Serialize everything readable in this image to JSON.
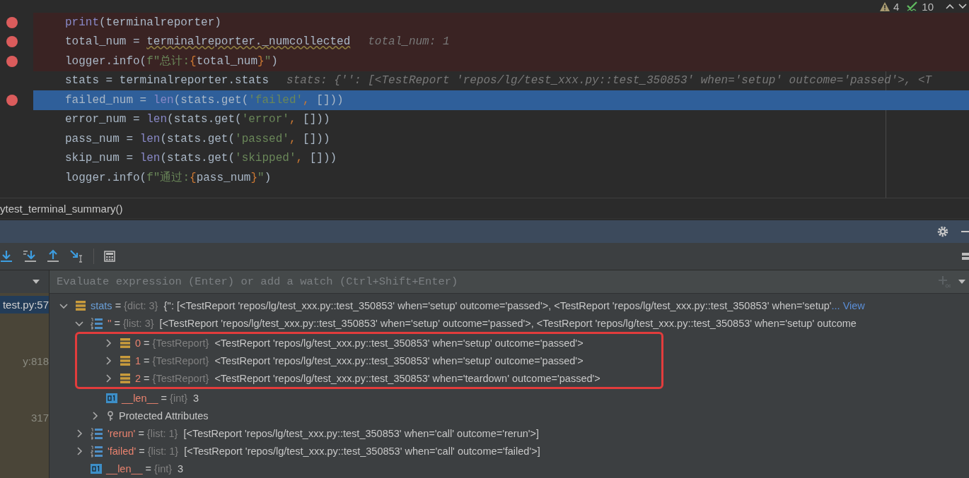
{
  "editor": {
    "inspections": {
      "warnings": "4",
      "checks": "10"
    },
    "lines": [
      {
        "breakpoint": true,
        "current": false,
        "tokens": [
          {
            "kind": "builtin",
            "text": "print"
          },
          {
            "kind": "plain",
            "text": "(terminalreporter)"
          }
        ]
      },
      {
        "breakpoint": true,
        "current": false,
        "tokens": [
          {
            "kind": "plain",
            "text": "total_num = "
          },
          {
            "kind": "warn",
            "text": "terminalreporter._numcollected"
          }
        ],
        "hint": "total_num: 1"
      },
      {
        "breakpoint": true,
        "current": false,
        "tokens": [
          {
            "kind": "plain",
            "text": "logger.info("
          },
          {
            "kind": "string",
            "text": "f\"总计:"
          },
          {
            "kind": "brace",
            "text": "{"
          },
          {
            "kind": "plain",
            "text": "total_num"
          },
          {
            "kind": "brace",
            "text": "}"
          },
          {
            "kind": "string",
            "text": "\""
          },
          {
            "kind": "plain",
            "text": ")"
          }
        ]
      },
      {
        "breakpoint": false,
        "current": false,
        "tokens": [
          {
            "kind": "plain",
            "text": "stats = terminalreporter.stats"
          }
        ],
        "hint": "stats: {'': [<TestReport 'repos/lg/test_xxx.py::test_350853' when='setup' outcome='passed'>, <T"
      },
      {
        "breakpoint": true,
        "current": true,
        "tokens": [
          {
            "kind": "plain",
            "text": "failed_num = "
          },
          {
            "kind": "builtin",
            "text": "len"
          },
          {
            "kind": "plain",
            "text": "(stats.get("
          },
          {
            "kind": "string",
            "text": "'failed'"
          },
          {
            "kind": "brace",
            "text": ", "
          },
          {
            "kind": "plain",
            "text": "[]))"
          }
        ]
      },
      {
        "breakpoint": false,
        "current": false,
        "tokens": [
          {
            "kind": "plain",
            "text": "error_num = "
          },
          {
            "kind": "builtin",
            "text": "len"
          },
          {
            "kind": "plain",
            "text": "(stats.get("
          },
          {
            "kind": "string",
            "text": "'error'"
          },
          {
            "kind": "brace",
            "text": ", "
          },
          {
            "kind": "plain",
            "text": "[]))"
          }
        ]
      },
      {
        "breakpoint": false,
        "current": false,
        "tokens": [
          {
            "kind": "plain",
            "text": "pass_num = "
          },
          {
            "kind": "builtin",
            "text": "len"
          },
          {
            "kind": "plain",
            "text": "(stats.get("
          },
          {
            "kind": "string",
            "text": "'passed'"
          },
          {
            "kind": "brace",
            "text": ", "
          },
          {
            "kind": "plain",
            "text": "[]))"
          }
        ]
      },
      {
        "breakpoint": false,
        "current": false,
        "tokens": [
          {
            "kind": "plain",
            "text": "skip_num = "
          },
          {
            "kind": "builtin",
            "text": "len"
          },
          {
            "kind": "plain",
            "text": "(stats.get("
          },
          {
            "kind": "string",
            "text": "'skipped'"
          },
          {
            "kind": "brace",
            "text": ", "
          },
          {
            "kind": "plain",
            "text": "[]))"
          }
        ]
      },
      {
        "breakpoint": false,
        "current": false,
        "tokens": [
          {
            "kind": "plain",
            "text": "logger.info("
          },
          {
            "kind": "string",
            "text": "f\"通过:"
          },
          {
            "kind": "brace",
            "text": "{"
          },
          {
            "kind": "plain",
            "text": "pass_num"
          },
          {
            "kind": "brace",
            "text": "}"
          },
          {
            "kind": "string",
            "text": "\""
          },
          {
            "kind": "plain",
            "text": ")"
          }
        ]
      }
    ]
  },
  "breadcrumb": "ytest_terminal_summary()",
  "debugger": {
    "evaluate": {
      "placeholder": "Evaluate expression (Enter) or add a watch (Ctrl+Shift+Enter)"
    },
    "frames": [
      {
        "label": "test.py:57",
        "selected": true
      },
      {
        "label": "y:818",
        "selected": false
      },
      {
        "label": "317",
        "selected": false
      }
    ],
    "variables": [
      {
        "name": "stats",
        "kind": "dict",
        "sep": "=",
        "type_label": "{dict: 3}",
        "value": "{'': [<TestReport 'repos/lg/test_xxx.py::test_350853' when='setup' outcome='passed'>, <TestReport 'repos/lg/test_xxx.py::test_350853' when='setup'",
        "link": "... View",
        "expanded": true,
        "children": [
          {
            "name": "''",
            "kind": "list",
            "sep": "=",
            "type_label": "{list: 3}",
            "value": "[<TestReport 'repos/lg/test_xxx.py::test_350853' when='setup' outcome='passed'>, <TestReport 'repos/lg/test_xxx.py::test_350853' when='setup' outcome",
            "expanded": true,
            "children": [
              {
                "name": "0",
                "kind": "object",
                "sep": "=",
                "type_label": "{TestReport}",
                "value": "<TestReport 'repos/lg/test_xxx.py::test_350853' when='setup' outcome='passed'>",
                "expanded": false,
                "highlighted": true
              },
              {
                "name": "1",
                "kind": "object",
                "sep": "=",
                "type_label": "{TestReport}",
                "value": "<TestReport 'repos/lg/test_xxx.py::test_350853' when='setup' outcome='passed'>",
                "expanded": false,
                "highlighted": true
              },
              {
                "name": "2",
                "kind": "object",
                "sep": "=",
                "type_label": "{TestReport}",
                "value": "<TestReport 'repos/lg/test_xxx.py::test_350853' when='teardown' outcome='passed'>",
                "expanded": false,
                "highlighted": true
              },
              {
                "name": "__len__",
                "kind": "int",
                "sep": "=",
                "type_label": "{int}",
                "value": "3"
              },
              {
                "name": "Protected Attributes",
                "kind": "protected",
                "expanded": false
              }
            ]
          },
          {
            "name": "'rerun'",
            "kind": "list",
            "sep": "=",
            "type_label": "{list: 1}",
            "value": "[<TestReport 'repos/lg/test_xxx.py::test_350853' when='call' outcome='rerun'>]",
            "expanded": false
          },
          {
            "name": "'failed'",
            "kind": "list",
            "sep": "=",
            "type_label": "{list: 1}",
            "value": "[<TestReport 'repos/lg/test_xxx.py::test_350853' when='call' outcome='failed'>]",
            "expanded": false
          },
          {
            "name": "__len__",
            "kind": "int",
            "sep": "=",
            "type_label": "{int}",
            "value": "3"
          }
        ]
      }
    ]
  }
}
